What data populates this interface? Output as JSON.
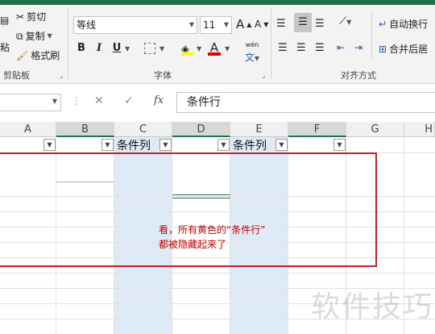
{
  "ribbon": {
    "clipboard": {
      "cut_label": "剪切",
      "copy_label": "复制",
      "format_painter_label": "格式刷",
      "paste_label_partial": "粘",
      "group_label": "剪贴板"
    },
    "font": {
      "font_name": "等线",
      "font_size": "11",
      "bold": "B",
      "italic": "I",
      "underline": "U",
      "grow": "A",
      "shrink": "A",
      "font_color_glyph": "A",
      "phonetic": "wén",
      "group_label": "字体"
    },
    "alignment": {
      "wrap_text_label": "自动换行",
      "merge_center_label": "合并后居",
      "group_label": "对齐方式"
    }
  },
  "formula_bar": {
    "fx_label": "fx",
    "content": "条件行"
  },
  "columns": [
    "A",
    "B",
    "C",
    "D",
    "E",
    "F",
    "G",
    "H"
  ],
  "header_row": {
    "c_label": "条件列",
    "e_label": "条件列"
  },
  "annotation": {
    "line1": "看，所有黄色的“条件行”",
    "line2": "都被隐藏起来了"
  },
  "watermark": "软件技巧",
  "colors": {
    "excel_green": "#217346",
    "highlight_blue": "#deebf7",
    "annotation_red": "#c00000"
  }
}
